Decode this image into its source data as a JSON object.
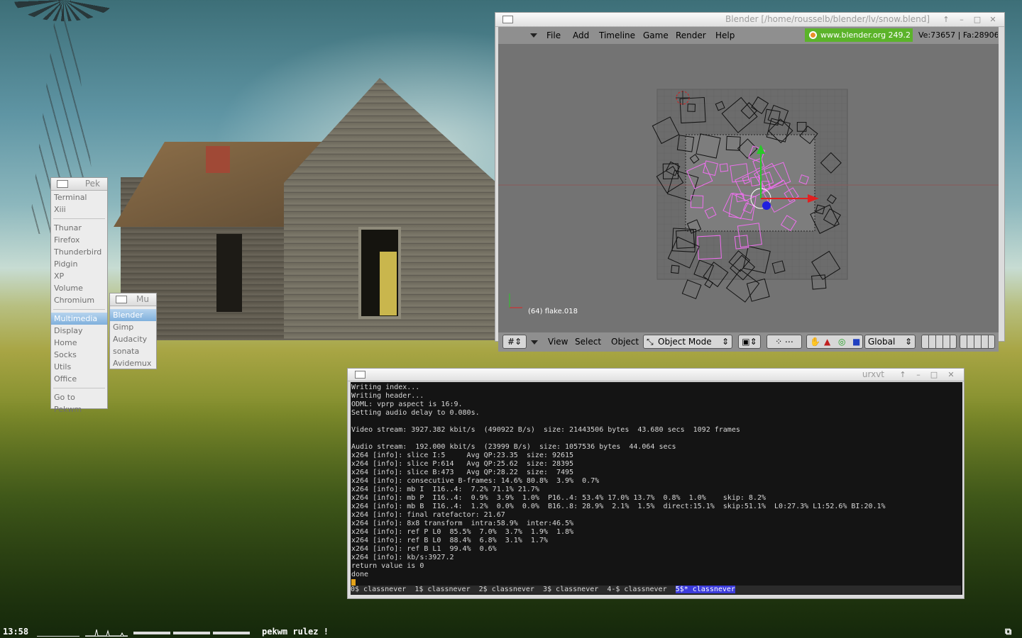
{
  "pekwm_root_menu": {
    "title": "Pek",
    "groups": [
      [
        "Terminal",
        "Xiii"
      ],
      [
        "Thunar",
        "Firefox",
        "Thunderbird",
        "Pidgin",
        "XP",
        "Volume",
        "Chromium"
      ],
      [
        "Multimedia",
        "Display",
        "Home",
        "Socks",
        "Utils",
        "Office"
      ],
      [
        "Go to",
        "Pekwm"
      ]
    ],
    "selected": "Multimedia"
  },
  "pekwm_submenu": {
    "title": "Mu",
    "items": [
      "Blender",
      "Gimp",
      "Audacity",
      "sonata",
      "Avidemux"
    ],
    "selected": "Blender"
  },
  "blender": {
    "title": "Blender [/home/rousselb/blender/lv/snow.blend]",
    "menu": [
      "File",
      "Add",
      "Timeline",
      "Game",
      "Render",
      "Help"
    ],
    "info_url": "www.blender.org 249.2",
    "stats": "Ve:73657 | Fa:28906",
    "viewport_label": "(64) flake.018",
    "footer": {
      "view": "View",
      "select": "Select",
      "object": "Object",
      "mode": "Object Mode",
      "orientation": "Global"
    }
  },
  "urxvt": {
    "title": "urxvt",
    "lines": [
      "Writing index...",
      "Writing header...",
      "ODML: vprp aspect is 16:9.",
      "Setting audio delay to 0.080s.",
      "",
      "Video stream: 3927.382 kbit/s  (490922 B/s)  size: 21443506 bytes  43.680 secs  1092 frames",
      "",
      "Audio stream:  192.000 kbit/s  (23999 B/s)  size: 1057536 bytes  44.064 secs",
      "x264 [info]: slice I:5     Avg QP:23.35  size: 92615",
      "x264 [info]: slice P:614   Avg QP:25.62  size: 28395",
      "x264 [info]: slice B:473   Avg QP:28.22  size:  7495",
      "x264 [info]: consecutive B-frames: 14.6% 80.8%  3.9%  0.7%",
      "x264 [info]: mb I  I16..4:  7.2% 71.1% 21.7%",
      "x264 [info]: mb P  I16..4:  0.9%  3.9%  1.0%  P16..4: 53.4% 17.0% 13.7%  0.8%  1.0%    skip: 8.2%",
      "x264 [info]: mb B  I16..4:  1.2%  0.0%  0.0%  B16..8: 28.9%  2.1%  1.5%  direct:15.1%  skip:51.1%  L0:27.3% L1:52.6% BI:20.1%",
      "x264 [info]: final ratefactor: 21.67",
      "x264 [info]: 8x8 transform  intra:58.9%  inter:46.5%",
      "x264 [info]: ref P L0  85.5%  7.0%  3.7%  1.9%  1.8%",
      "x264 [info]: ref B L0  88.4%  6.8%  3.1%  1.7%",
      "x264 [info]: ref B L1  99.4%  0.6%",
      "x264 [info]: kb/s:3927.2",
      "return value is 0",
      "done"
    ],
    "screens": [
      "0$ classnever",
      "1$ classnever",
      "2$ classnever",
      "3$ classnever",
      "4-$ classnever"
    ],
    "active_screen": "5$* classnever"
  },
  "panel": {
    "clock": "13:58",
    "message": "pekwm rulez !"
  },
  "colors": {
    "menu_selection": "#7fb0dd",
    "blender_info_green": "#5bb32a",
    "terminal_active_tab": "#3c3cdc",
    "cursor": "#e3a21a"
  }
}
